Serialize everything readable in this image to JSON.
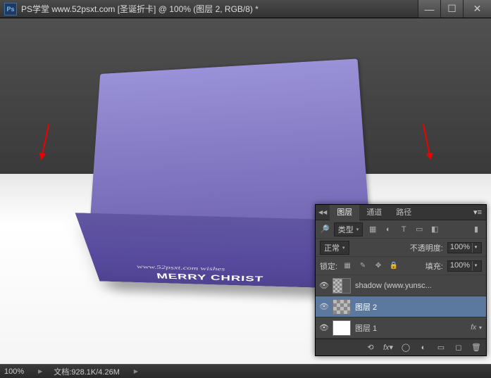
{
  "titlebar": {
    "icon_text": "Ps",
    "title": "PS学堂  www.52psxt.com [圣诞折卡] @ 100% (图层 2, RGB/8) *"
  },
  "canvas": {
    "card_text1": "www.52psxt.com   wishes",
    "card_text2": "MERRY CHRIST"
  },
  "statusbar": {
    "zoom": "100%",
    "doc_label": "文档:",
    "doc_value": "928.1K/4.26M"
  },
  "panel": {
    "tabs": [
      "图层",
      "通道",
      "路径"
    ],
    "filter_label": "类型",
    "blend_mode": "正常",
    "opacity_label": "不透明度:",
    "opacity_value": "100%",
    "lock_label": "锁定:",
    "fill_label": "填充:",
    "fill_value": "100%",
    "layers": [
      {
        "name": "shadow (www.yunsc...",
        "thumb": "mask",
        "visible": true
      },
      {
        "name": "图层 2",
        "thumb": "checker",
        "visible": true,
        "selected": true
      },
      {
        "name": "图层 1",
        "thumb": "white",
        "visible": true,
        "fx": true
      }
    ],
    "footer_icons": [
      "link",
      "fx",
      "mask",
      "adjust",
      "group",
      "new",
      "trash"
    ]
  }
}
